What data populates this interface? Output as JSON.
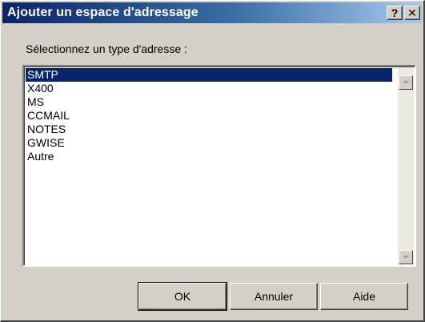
{
  "window": {
    "title": "Ajouter un espace d'adressage",
    "help_glyph": "?",
    "close_glyph": "✕"
  },
  "dialog": {
    "prompt": "Sélectionnez un type d'adresse :",
    "list": {
      "selected": "SMTP",
      "items": [
        "SMTP",
        "X400",
        "MS",
        "CCMAIL",
        "NOTES",
        "GWISE",
        "Autre"
      ]
    }
  },
  "buttons": {
    "ok": "OK",
    "cancel": "Annuler",
    "help": "Aide"
  }
}
